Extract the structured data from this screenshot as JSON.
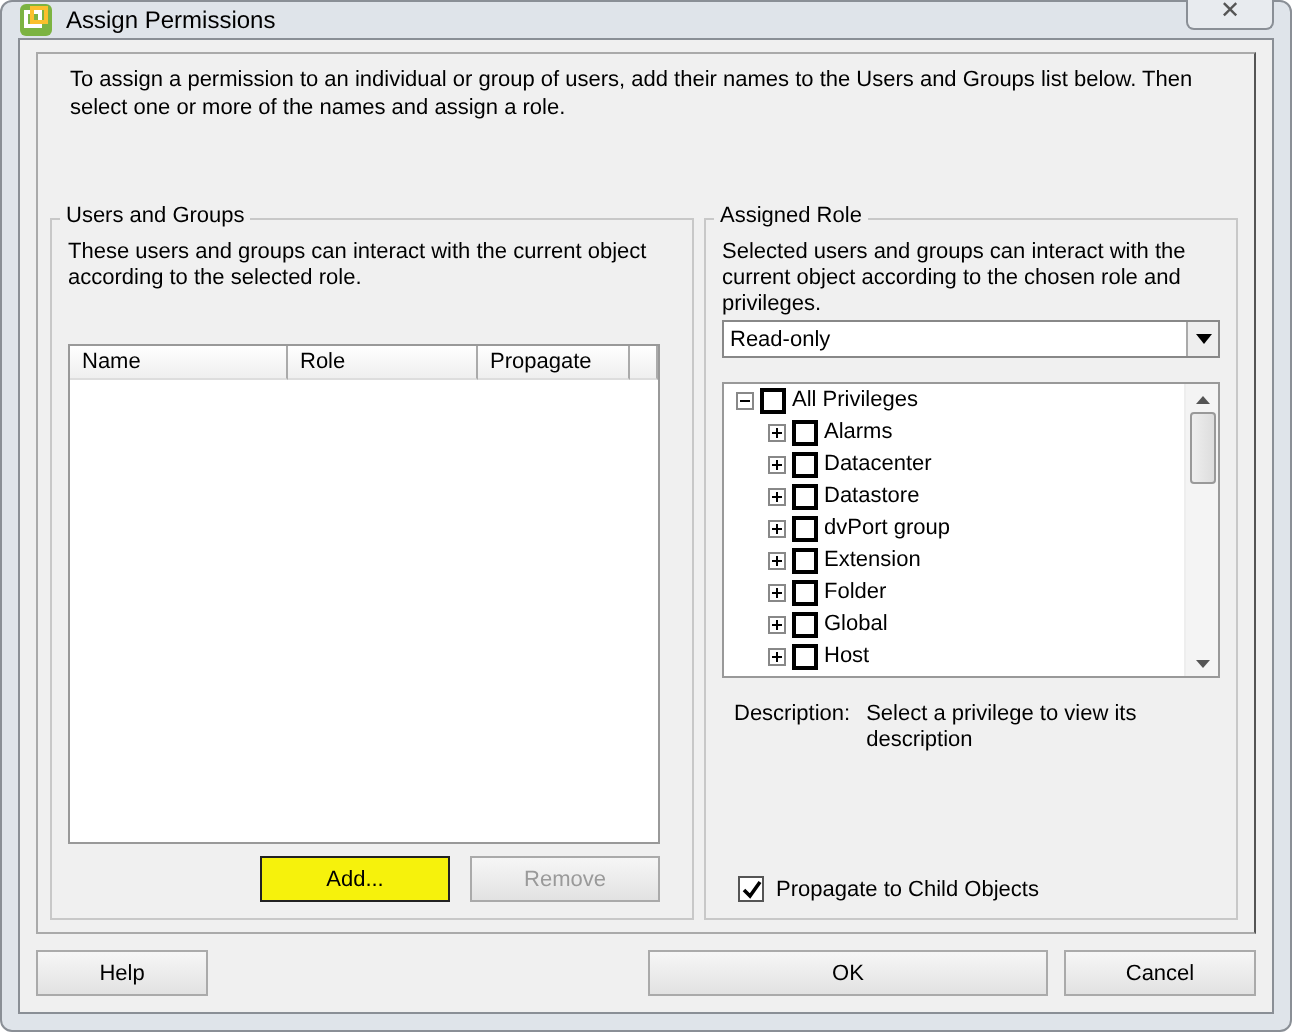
{
  "window": {
    "title": "Assign Permissions",
    "close_label": "✕"
  },
  "intro": "To assign a permission to an individual or group of users, add their names to the Users and Groups list below. Then select one or more of the names and assign a role.",
  "users_groups": {
    "title": "Users and Groups",
    "description": "These users and groups can interact with the current object according to the selected role.",
    "table": {
      "columns": [
        "Name",
        "Role",
        "Propagate"
      ]
    },
    "buttons": [
      {
        "label": "Add...",
        "disabled": false,
        "highlighted": true
      },
      {
        "label": "Remove",
        "disabled": true,
        "highlighted": false
      }
    ]
  },
  "assigned_role": {
    "title": "Assigned Role",
    "description": "Selected users and groups can interact with the current object according to the chosen role and privileges.",
    "role_select": {
      "value": "Read-only"
    },
    "privileges": [
      {
        "label": "All Privileges",
        "checked": false,
        "expanded": true,
        "children": [
          {
            "label": "Alarms",
            "checked": false,
            "expanded": false
          },
          {
            "label": "Datacenter",
            "checked": false,
            "expanded": false
          },
          {
            "label": "Datastore",
            "checked": false,
            "expanded": false
          },
          {
            "label": "dvPort group",
            "checked": false,
            "expanded": false
          },
          {
            "label": "Extension",
            "checked": false,
            "expanded": false
          },
          {
            "label": "Folder",
            "checked": false,
            "expanded": false
          },
          {
            "label": "Global",
            "checked": false,
            "expanded": false
          },
          {
            "label": "Host",
            "checked": false,
            "expanded": false
          }
        ]
      }
    ],
    "description_label": "Description:",
    "description_value": "Select a privilege to view its description",
    "propagate": {
      "label": "Propagate to Child Objects",
      "checked": true
    }
  },
  "footer_buttons": [
    {
      "label": "Help"
    },
    {
      "label": "OK"
    },
    {
      "label": "Cancel"
    }
  ]
}
